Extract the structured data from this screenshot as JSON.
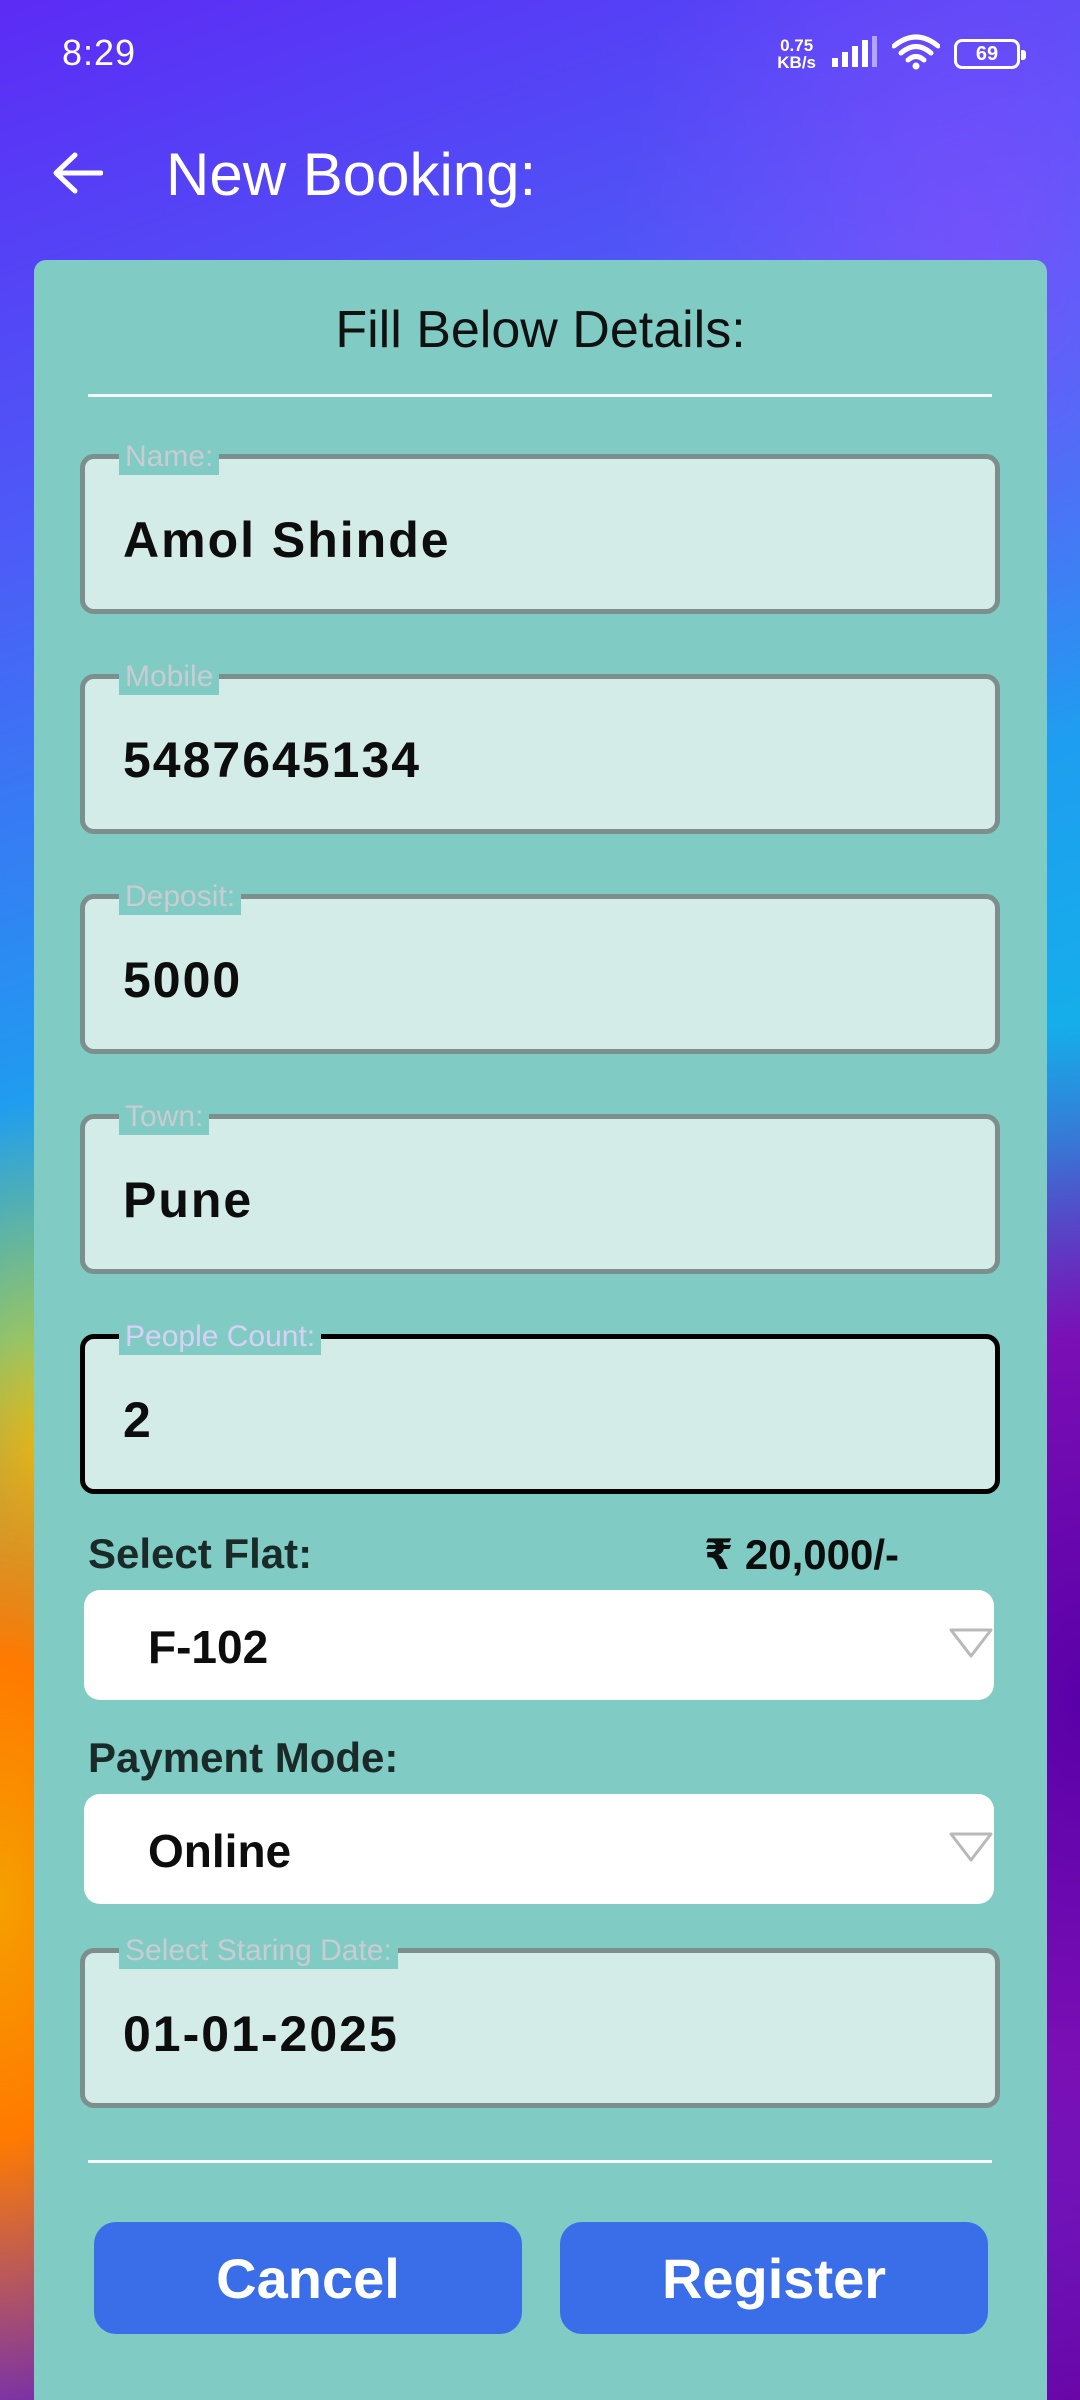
{
  "status_bar": {
    "time": "8:29",
    "net_speed_value": "0.75",
    "net_speed_unit": "KB/s",
    "battery": "69"
  },
  "app_bar": {
    "title": "New Booking:",
    "back_icon": "arrow-left-icon"
  },
  "form": {
    "heading": "Fill Below Details:",
    "fields": [
      {
        "label": "Name:",
        "value": "Amol Shinde"
      },
      {
        "label": "Mobile",
        "value": "5487645134"
      },
      {
        "label": "Deposit:",
        "value": "5000"
      },
      {
        "label": "Town:",
        "value": "Pune"
      },
      {
        "label": "People Count:",
        "value": "2"
      }
    ],
    "flat_label": "Select Flat:",
    "flat_price": "₹ 20,000/-",
    "flat_selected": "F-102",
    "payment_label": "Payment Mode:",
    "payment_selected": "Online",
    "date_label": "Select Staring Date:",
    "date_value": "01-01-2025",
    "cancel_label": "Cancel",
    "register_label": "Register"
  },
  "colors": {
    "card": "#80cbc4",
    "field_fill": "#d4ece8",
    "button": "#3a6ee8"
  }
}
